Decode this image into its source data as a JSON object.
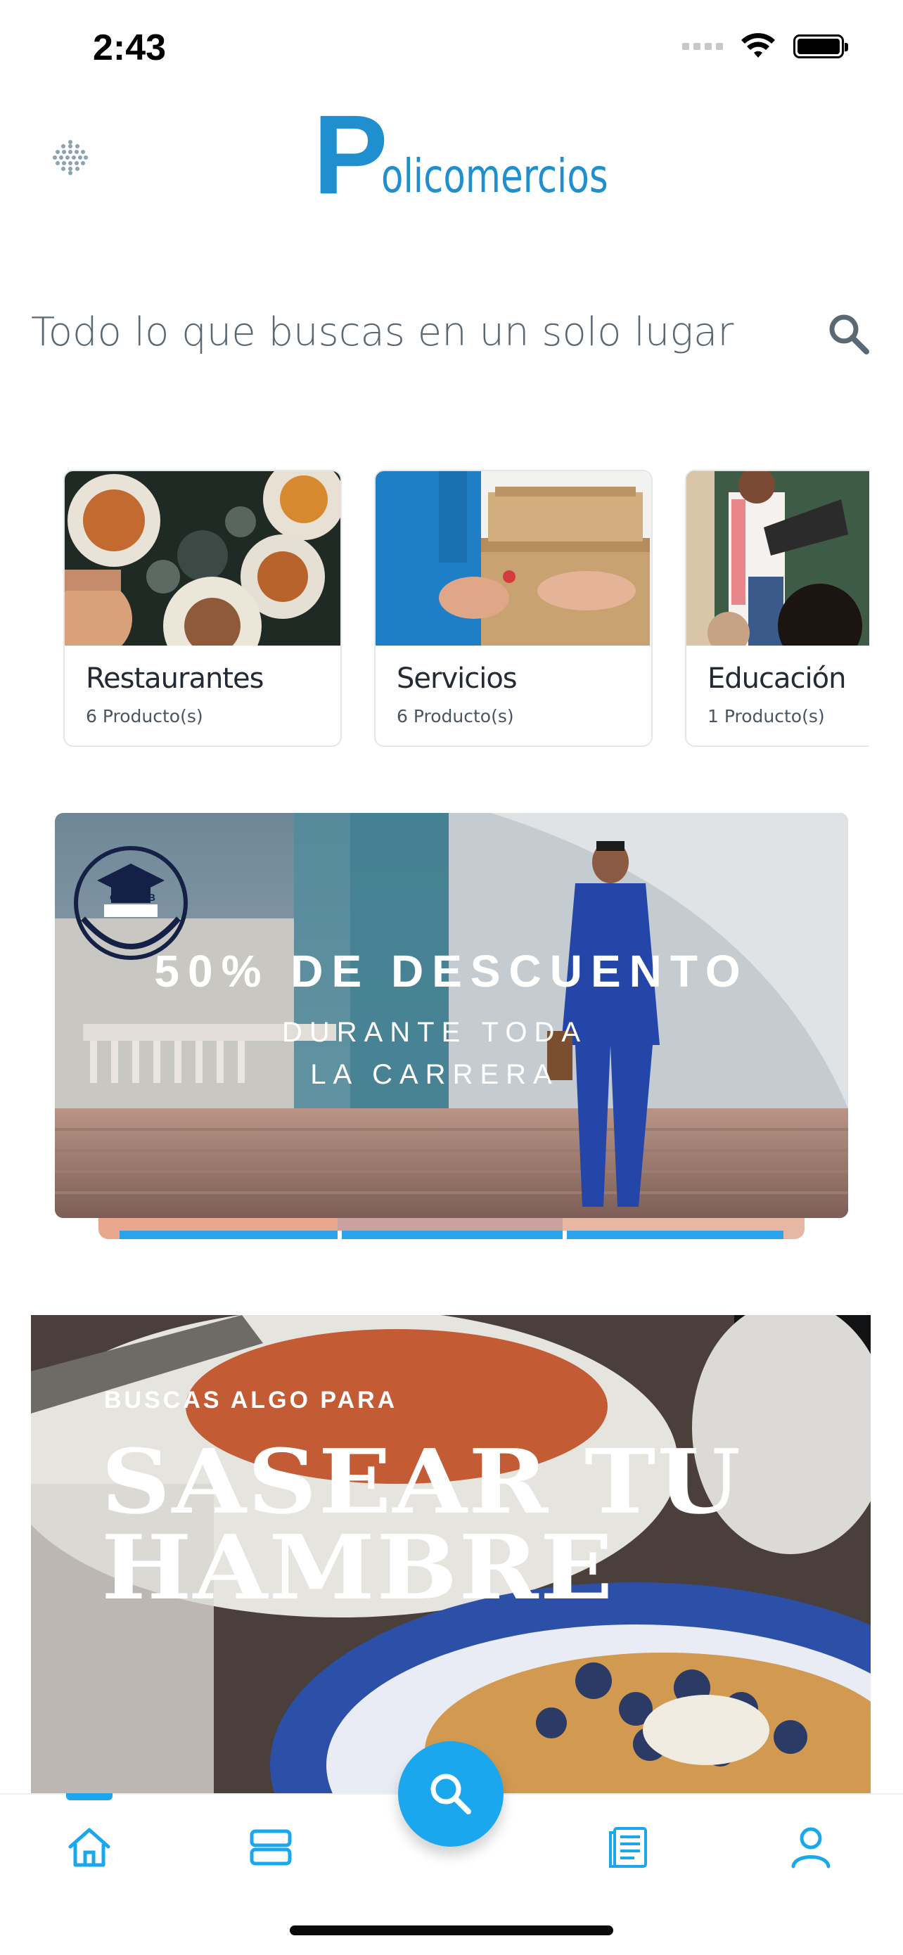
{
  "status_bar": {
    "time": "2:43"
  },
  "header": {
    "menu_icon": "dot-grid-icon",
    "logo_initial": "P",
    "logo_rest": "olicomercios",
    "brand_color": "#1f8fd0"
  },
  "search": {
    "text": "Todo lo que buscas en un solo lugar",
    "icon": "search-icon"
  },
  "categories": [
    {
      "name": "Restaurantes",
      "count": "6 Producto(s)"
    },
    {
      "name": "Servicios",
      "count": "6 Producto(s)"
    },
    {
      "name": "Educación",
      "count": "1 Producto(s)"
    }
  ],
  "banners": {
    "education": {
      "seal_text": "CEPROB",
      "title": "50% DE DESCUENTO",
      "subtitle": "DURANTE TODA LA CARRERA"
    },
    "food": {
      "kicker": "BUSCAS ALGO PARA",
      "headline_line1": "SASEAR TU",
      "headline_line2": "HAMBRE"
    }
  },
  "tab_bar": {
    "accent": "#1aa7ee",
    "items": [
      {
        "icon": "home-icon",
        "active": true
      },
      {
        "icon": "list-icon",
        "active": false
      },
      {
        "icon": "search-icon",
        "active": false
      },
      {
        "icon": "document-icon",
        "active": false
      },
      {
        "icon": "user-icon",
        "active": false
      }
    ]
  }
}
